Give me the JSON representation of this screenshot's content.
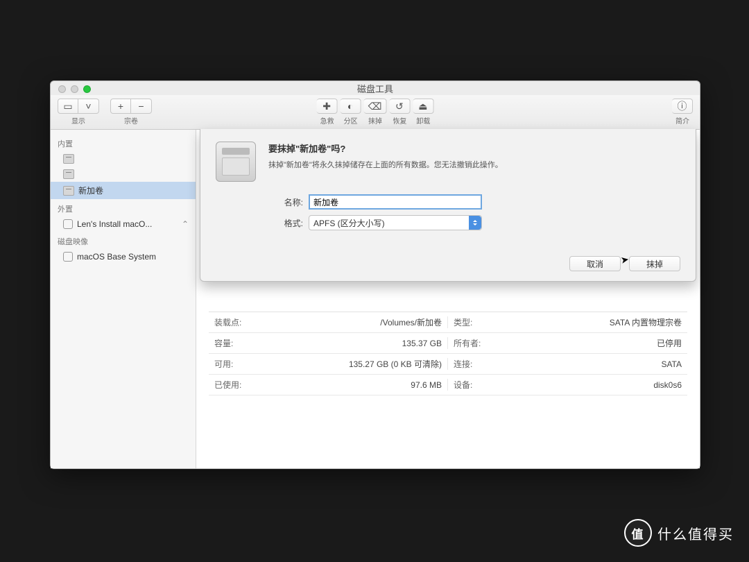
{
  "window": {
    "title": "磁盘工具"
  },
  "toolbar": {
    "view": "显示",
    "volume": "宗卷",
    "firstaid": "急救",
    "partition": "分区",
    "erase": "抹掉",
    "restore": "恢复",
    "unmount": "卸载",
    "info": "简介"
  },
  "sidebar": {
    "internal": "内置",
    "external": "外置",
    "images": "磁盘映像",
    "item_selected": "新加卷",
    "item_external": "Len's Install macO...",
    "item_image": "macOS Base System"
  },
  "capacity_box": "135.37 GB",
  "info": {
    "mount_label": "装载点:",
    "mount_value": "/Volumes/新加卷",
    "capacity_label": "容量:",
    "capacity_value": "135.37 GB",
    "avail_label": "可用:",
    "avail_value": "135.27 GB (0 KB 可清除)",
    "used_label": "已使用:",
    "used_value": "97.6 MB",
    "type_label": "类型:",
    "type_value": "SATA 内置物理宗卷",
    "owner_label": "所有者:",
    "owner_value": "已停用",
    "conn_label": "连接:",
    "conn_value": "SATA",
    "device_label": "设备:",
    "device_value": "disk0s6"
  },
  "dialog": {
    "title": "要抹掉\"新加卷\"吗?",
    "message": "抹掉\"新加卷\"将永久抹掉储存在上面的所有数据。您无法撤销此操作。",
    "name_label": "名称:",
    "name_value": "新加卷",
    "format_label": "格式:",
    "format_value": "APFS (区分大小写)",
    "cancel": "取消",
    "erase": "抹掉"
  },
  "watermark": {
    "badge": "值",
    "text": "什么值得买"
  }
}
